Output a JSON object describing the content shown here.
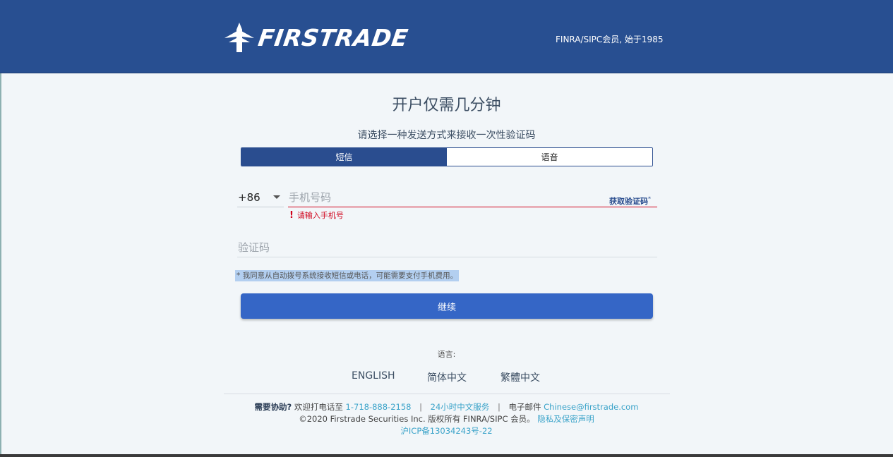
{
  "header": {
    "brand": "FIRSTRADE",
    "tagline": "FINRA/SIPC会员, 始于1985"
  },
  "main": {
    "title": "开户仅需几分钟",
    "subtitle": "请选择一种发送方式来接收一次性验证码",
    "tabs": [
      {
        "label": "短信",
        "active": true
      },
      {
        "label": "语音",
        "active": false
      }
    ],
    "phone": {
      "country_code": "+86",
      "placeholder": "手机号码",
      "value": "",
      "get_code_label": "获取验证码",
      "get_code_marker": "*",
      "error": "请输入手机号"
    },
    "code": {
      "placeholder": "验证码",
      "value": ""
    },
    "consent": "* 我同意从自动拨号系统接收短信或电话，可能需要支付手机费用。",
    "continue_label": "继续"
  },
  "language": {
    "label": "语言:",
    "options": [
      "ENGLISH",
      "简体中文",
      "繁體中文"
    ]
  },
  "footer": {
    "help_label": "需要协助?",
    "call_text": "欢迎打电话至",
    "phone": "1-718-888-2158",
    "service": "24小时中文服务",
    "email_label": "电子邮件",
    "email": "Chinese@firstrade.com",
    "copyright": "©2020 Firstrade Securities Inc. 版权所有 FINRA/SIPC 会员。",
    "privacy": "隐私及保密声明",
    "icp": "沪ICP备13034243号-22"
  },
  "colors": {
    "header_bg": "#284f91",
    "primary": "#3566c6",
    "error": "#d0021b",
    "link": "#3aa3c9"
  }
}
